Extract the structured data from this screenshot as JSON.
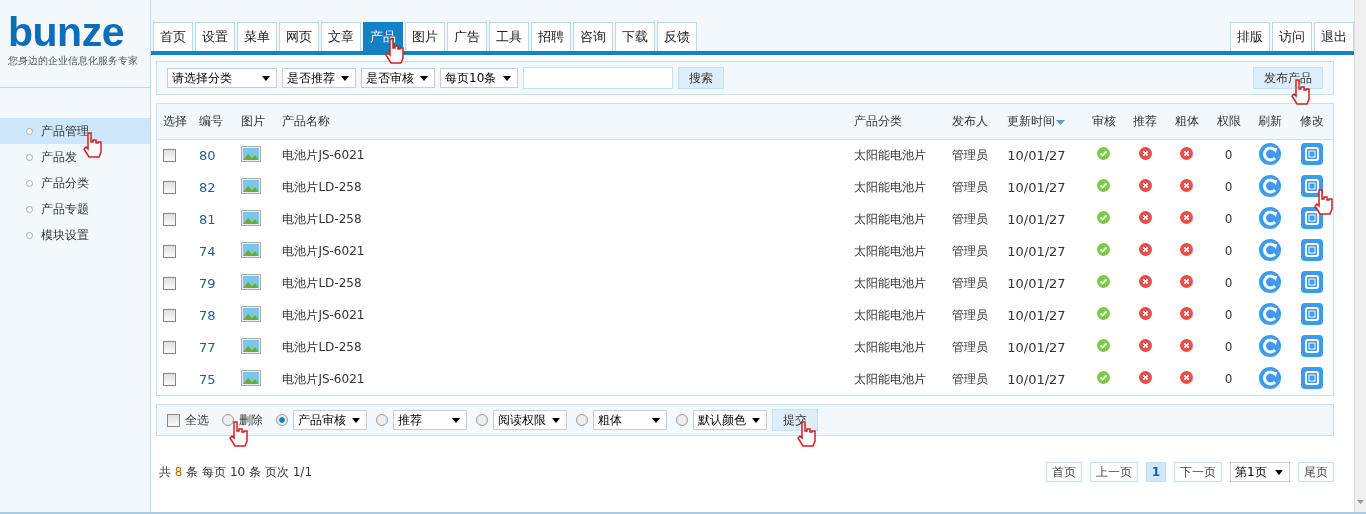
{
  "logo": {
    "name": "bunze",
    "tagline": "您身边的企业信息化服务专家"
  },
  "sidebar": {
    "items": [
      {
        "label": "产品管理",
        "selected": true
      },
      {
        "label": "产品发",
        "selected": false
      },
      {
        "label": "产品分类",
        "selected": false
      },
      {
        "label": "产品专题",
        "selected": false
      },
      {
        "label": "模块设置",
        "selected": false
      }
    ]
  },
  "tabs": [
    {
      "label": "首页",
      "selected": false
    },
    {
      "label": "设置",
      "selected": false
    },
    {
      "label": "菜单",
      "selected": false
    },
    {
      "label": "网页",
      "selected": false
    },
    {
      "label": "文章",
      "selected": false
    },
    {
      "label": "产品",
      "selected": true
    },
    {
      "label": "图片",
      "selected": false
    },
    {
      "label": "广告",
      "selected": false
    },
    {
      "label": "工具",
      "selected": false
    },
    {
      "label": "招聘",
      "selected": false
    },
    {
      "label": "咨询",
      "selected": false
    },
    {
      "label": "下载",
      "selected": false
    },
    {
      "label": "反馈",
      "selected": false
    }
  ],
  "right_tabs": [
    "排版",
    "访问",
    "退出"
  ],
  "toolbar": {
    "filters": [
      "请选择分类",
      "是否推荐",
      "是否审核",
      "每页10条"
    ],
    "search_button": "搜索",
    "add_button": "发布产品"
  },
  "table": {
    "columns": [
      {
        "label": "选择",
        "sorted": false
      },
      {
        "label": "编号",
        "sorted": false
      },
      {
        "label": "图片",
        "sorted": false
      },
      {
        "label": "产品名称",
        "sorted": false
      },
      {
        "label": "产品分类",
        "sorted": false
      },
      {
        "label": "发布人",
        "sorted": false
      },
      {
        "label": "更新时间",
        "sorted": true
      },
      {
        "label": "审核",
        "sorted": false
      },
      {
        "label": "推荐",
        "sorted": false
      },
      {
        "label": "粗体",
        "sorted": false
      },
      {
        "label": "权限",
        "sorted": false
      },
      {
        "label": "刷新",
        "sorted": false
      },
      {
        "label": "修改",
        "sorted": false
      }
    ],
    "rows": [
      {
        "checked": false,
        "id": "80",
        "name": "电池片JS-6021",
        "category": "太阳能电池片",
        "publisher": "管理员",
        "updated": "10/01/27",
        "approved": true,
        "recommended": false,
        "bold": false,
        "permission": "0"
      },
      {
        "checked": false,
        "id": "82",
        "name": "电池片LD-258",
        "category": "太阳能电池片",
        "publisher": "管理员",
        "updated": "10/01/27",
        "approved": true,
        "recommended": false,
        "bold": false,
        "permission": "0"
      },
      {
        "checked": false,
        "id": "81",
        "name": "电池片LD-258",
        "category": "太阳能电池片",
        "publisher": "管理员",
        "updated": "10/01/27",
        "approved": true,
        "recommended": false,
        "bold": false,
        "permission": "0"
      },
      {
        "checked": false,
        "id": "74",
        "name": "电池片JS-6021",
        "category": "太阳能电池片",
        "publisher": "管理员",
        "updated": "10/01/27",
        "approved": true,
        "recommended": false,
        "bold": false,
        "permission": "0"
      },
      {
        "checked": false,
        "id": "79",
        "name": "电池片LD-258",
        "category": "太阳能电池片",
        "publisher": "管理员",
        "updated": "10/01/27",
        "approved": true,
        "recommended": false,
        "bold": false,
        "permission": "0"
      },
      {
        "checked": false,
        "id": "78",
        "name": "电池片JS-6021",
        "category": "太阳能电池片",
        "publisher": "管理员",
        "updated": "10/01/27",
        "approved": true,
        "recommended": false,
        "bold": false,
        "permission": "0"
      },
      {
        "checked": false,
        "id": "77",
        "name": "电池片LD-258",
        "category": "太阳能电池片",
        "publisher": "管理员",
        "updated": "10/01/27",
        "approved": true,
        "recommended": false,
        "bold": false,
        "permission": "0"
      },
      {
        "checked": false,
        "id": "75",
        "name": "电池片JS-6021",
        "category": "太阳能电池片",
        "publisher": "管理员",
        "updated": "10/01/27",
        "approved": true,
        "recommended": false,
        "bold": false,
        "permission": "0"
      }
    ]
  },
  "batch_bar": {
    "select_all": {
      "label": "全选",
      "checked": false
    },
    "options": [
      {
        "kind": "text",
        "label": "删除",
        "selected": false
      },
      {
        "kind": "select",
        "label": "产品审核",
        "selected": true
      },
      {
        "kind": "select",
        "label": "推荐",
        "selected": false
      },
      {
        "kind": "select",
        "label": "阅读权限",
        "selected": false
      },
      {
        "kind": "select",
        "label": "粗体",
        "selected": false
      },
      {
        "kind": "select",
        "label": "默认颜色",
        "selected": false
      }
    ],
    "submit": "提交"
  },
  "footer": {
    "summary": [
      {
        "text": "共",
        "highlight": false
      },
      {
        "text": "8",
        "highlight": true
      },
      {
        "text": "条",
        "highlight": false
      },
      {
        "text": "每页",
        "highlight": false
      },
      {
        "text": "10",
        "highlight": false
      },
      {
        "text": "条",
        "highlight": false
      },
      {
        "text": "页次",
        "highlight": false
      },
      {
        "text": "1/1",
        "highlight": false
      }
    ],
    "pagination": [
      {
        "kind": "link",
        "label": "首页",
        "selected": false
      },
      {
        "kind": "link",
        "label": "上一页",
        "selected": false
      },
      {
        "kind": "link",
        "label": "1",
        "selected": true
      },
      {
        "kind": "link",
        "label": "下一页",
        "selected": false
      },
      {
        "kind": "select",
        "label": "第1页"
      },
      {
        "kind": "link",
        "label": "尾页",
        "selected": false
      }
    ]
  }
}
